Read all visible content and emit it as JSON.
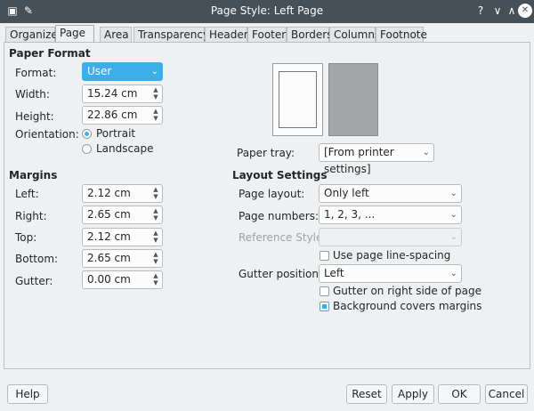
{
  "window": {
    "title": "Page Style: Left Page",
    "help_glyph": "?",
    "minimize_glyph": "∨",
    "maximize_glyph": "∧",
    "close_glyph": "✕",
    "pin_glyph": "✎"
  },
  "tabs": [
    {
      "label": "Organizer"
    },
    {
      "label": "Page"
    },
    {
      "label": "Area"
    },
    {
      "label": "Transparency"
    },
    {
      "label": "Header"
    },
    {
      "label": "Footer"
    },
    {
      "label": "Borders"
    },
    {
      "label": "Columns"
    },
    {
      "label": "Footnote"
    }
  ],
  "paper_format": {
    "title": "Paper Format",
    "format_label": "Format:",
    "format_value": "User",
    "width_label": "Width:",
    "width_value": "15.24 cm",
    "height_label": "Height:",
    "height_value": "22.86 cm",
    "orientation_label": "Orientation:",
    "portrait_label": "Portrait",
    "landscape_label": "Landscape"
  },
  "margins": {
    "title": "Margins",
    "left_label": "Left:",
    "left_value": "2.12 cm",
    "right_label": "Right:",
    "right_value": "2.65 cm",
    "top_label": "Top:",
    "top_value": "2.12 cm",
    "bottom_label": "Bottom:",
    "bottom_value": "2.65 cm",
    "gutter_label": "Gutter:",
    "gutter_value": "0.00 cm"
  },
  "paper_tray": {
    "label": "Paper tray:",
    "value": "[From printer settings]"
  },
  "layout": {
    "title": "Layout Settings",
    "page_layout_label": "Page layout:",
    "page_layout_value": "Only left",
    "page_numbers_label": "Page numbers:",
    "page_numbers_value": "1, 2, 3, ...",
    "reference_style_label": "Reference Style:",
    "reference_style_value": "",
    "use_line_spacing_label": "Use page line-spacing",
    "gutter_position_label": "Gutter position:",
    "gutter_position_value": "Left",
    "gutter_right_label": "Gutter on right side of page",
    "bg_covers_label": "Background covers margins"
  },
  "buttons": {
    "help": "Help",
    "reset": "Reset",
    "apply": "Apply",
    "ok": "OK",
    "cancel": "Cancel"
  },
  "spin_arrows": {
    "up": "▲",
    "down": "▼"
  },
  "caret_glyph": "⌄"
}
